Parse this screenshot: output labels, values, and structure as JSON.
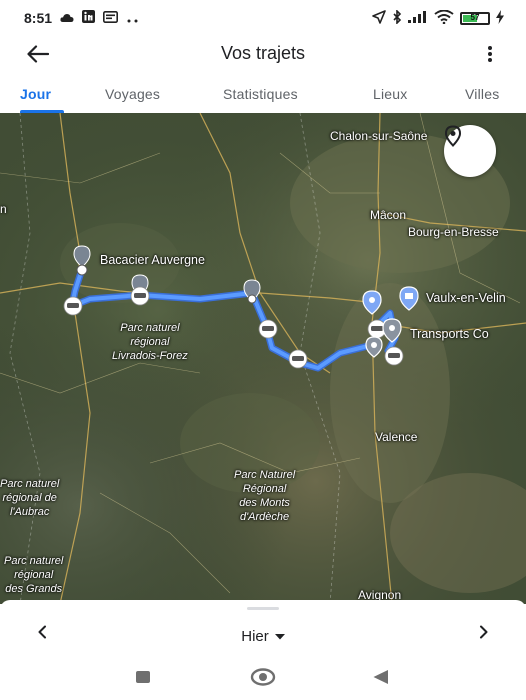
{
  "status_bar": {
    "time": "8:51",
    "left_icons": [
      "cloud-icon",
      "linkedin-icon",
      "message-icon",
      "more-dots-icon"
    ],
    "right_icons": [
      "location-arrow-icon",
      "bluetooth-icon",
      "signal-icon",
      "wifi-icon",
      "battery-icon",
      "charging-icon"
    ],
    "battery_text": "57"
  },
  "app_bar": {
    "title": "Vos trajets",
    "back_icon": "arrow-left-icon",
    "menu_icon": "more-vert-icon"
  },
  "tabs": [
    {
      "label": "Jour",
      "active": true
    },
    {
      "label": "Voyages",
      "active": false
    },
    {
      "label": "Statistiques",
      "active": false
    },
    {
      "label": "Lieux",
      "active": false
    },
    {
      "label": "Villes",
      "active": false
    }
  ],
  "map": {
    "places": {
      "chalon": "Chalon-sur-Saône",
      "macon": "Mâcon",
      "bourg": "Bourg-en-Bresse",
      "valence": "Valence",
      "avignon": "Avignon",
      "left_edge": "n"
    },
    "pois": {
      "bacacier": "Bacacier Auvergne",
      "vaulx": "Vaulx-en-Velin",
      "transports": "Transports Co"
    },
    "parks": {
      "livradois": "Parc naturel\nrégional\nLivradois-Forez",
      "ardeche": "Parc Naturel\nRégional\ndes Monts\nd'Ardèche",
      "aubrac": "Parc naturel\nrégional de\nl'Aubrac",
      "grands": "Parc naturel\nrégional\ndes Grands"
    },
    "route_color": "#4a8af4",
    "my_location_icon": "map-pin-icon"
  },
  "date_nav": {
    "label": "Hier",
    "prev_icon": "chevron-left-icon",
    "next_icon": "chevron-right-icon",
    "dropdown_icon": "caret-down-icon"
  },
  "nav_bar": {
    "recents_icon": "square-icon",
    "home_icon": "circle-icon",
    "back_icon": "triangle-back-icon"
  }
}
